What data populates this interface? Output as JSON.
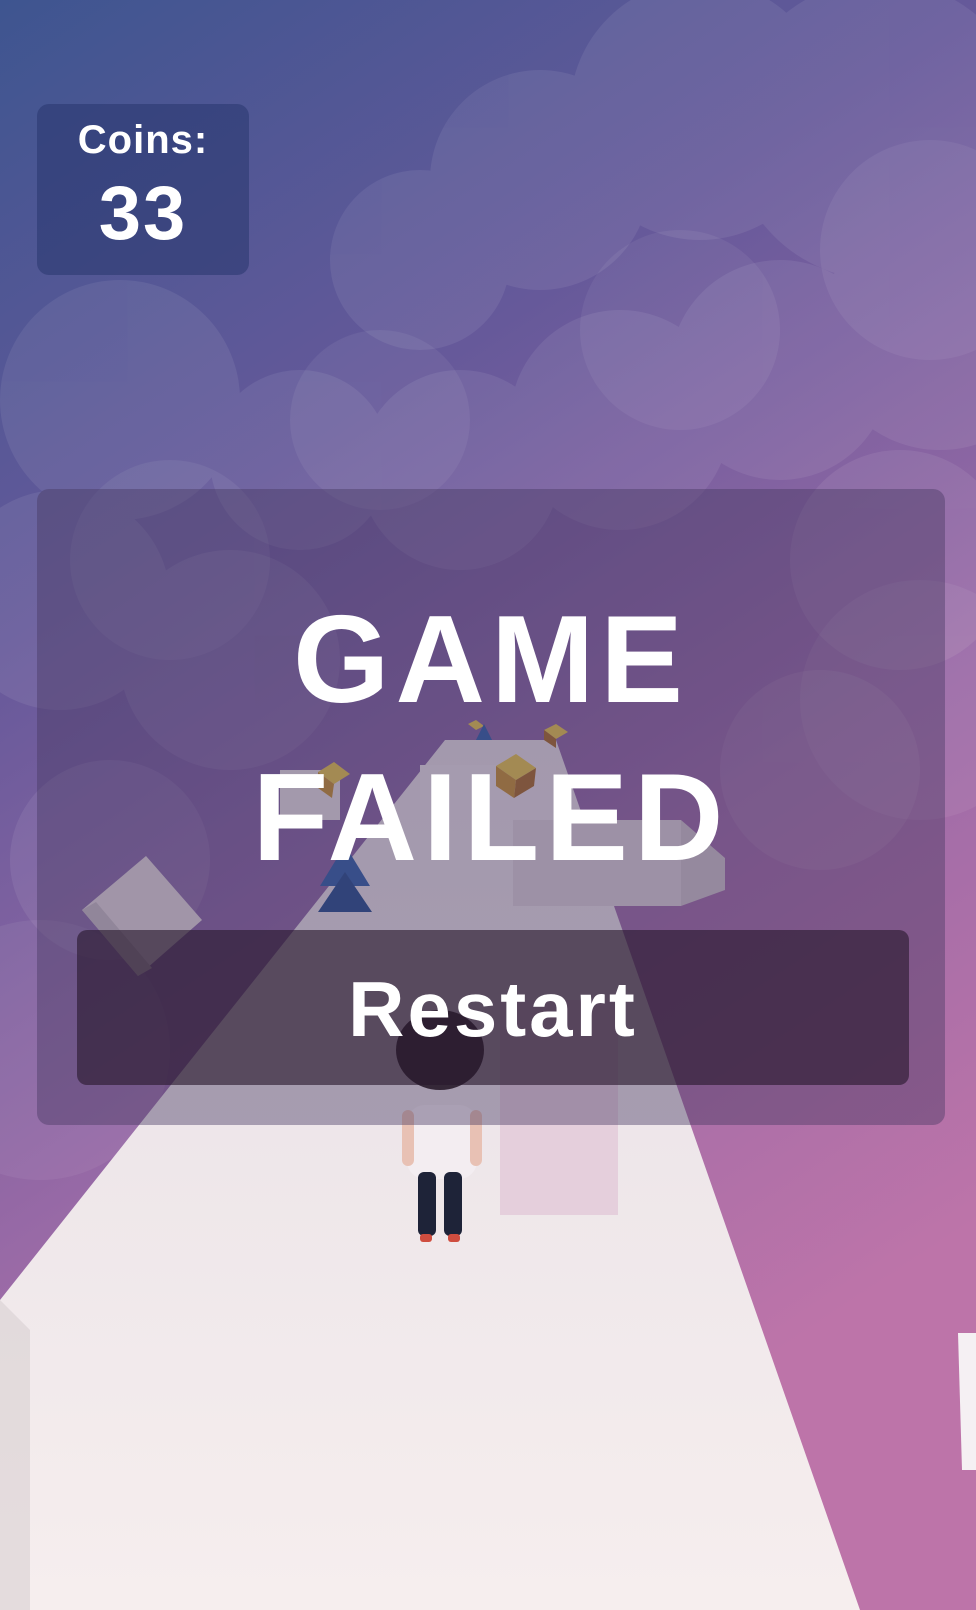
{
  "hud": {
    "coins_label": "Coins:",
    "coins_value": "33"
  },
  "fail_screen": {
    "title_line1": "GAME",
    "title_line2": "FAILED",
    "restart_label": "Restart"
  },
  "colors": {
    "sky_top": "#3f5590",
    "sky_bottom": "#bb74a9",
    "road": "#f4ecec",
    "coin": "#d6a73a",
    "spike": "#2f5fa8"
  }
}
